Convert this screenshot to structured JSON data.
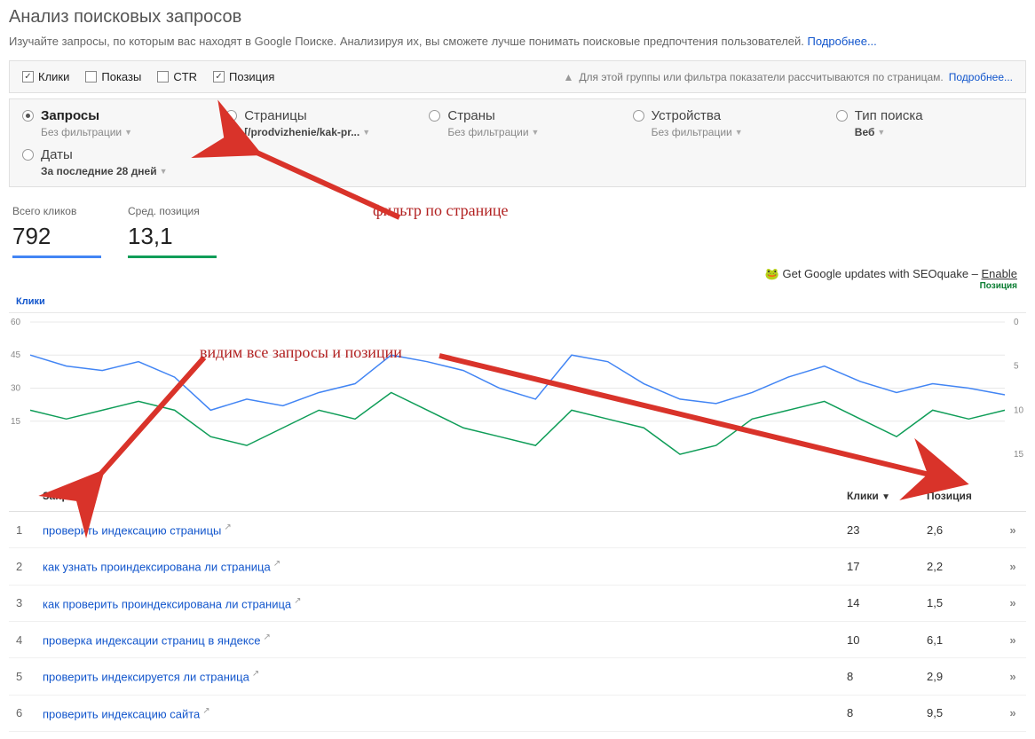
{
  "page": {
    "title": "Анализ поисковых запросов",
    "subtitle": "Изучайте запросы, по которым вас находят в Google Поиске. Анализируя их, вы сможете лучше понимать поисковые предпочтения пользователей.",
    "more_link": "Подробнее..."
  },
  "metrics": {
    "clicks": "Клики",
    "impressions": "Показы",
    "ctr": "CTR",
    "position": "Позиция",
    "note": "Для этой группы или фильтра показатели рассчитываются по страницам.",
    "note_link": "Подробнее..."
  },
  "filters": {
    "queries": {
      "label": "Запросы",
      "sub": "Без фильтрации"
    },
    "pages": {
      "label": "Страницы",
      "sub": "[/prodvizhenie/kak-pr..."
    },
    "countries": {
      "label": "Страны",
      "sub": "Без фильтрации"
    },
    "devices": {
      "label": "Устройства",
      "sub": "Без фильтрации"
    },
    "searchtype": {
      "label": "Тип поиска",
      "sub": "Веб"
    },
    "dates": {
      "label": "Даты",
      "sub": "За последние 28 дней"
    }
  },
  "stats": {
    "clicks_label": "Всего кликов",
    "clicks_value": "792",
    "pos_label": "Сред. позиция",
    "pos_value": "13,1"
  },
  "annotations": {
    "filter": "фильтр по странице",
    "queries": "видим все запросы и позиции"
  },
  "seoquake": {
    "text": "Get Google updates with SEOquake – ",
    "enable": "Enable",
    "position": "Позиция"
  },
  "chart_legend": {
    "clicks": "Клики"
  },
  "chart_data": {
    "type": "line",
    "y_left_ticks": [
      60,
      45,
      30,
      15
    ],
    "y_right_ticks": [
      0,
      5,
      10,
      15
    ],
    "x": [
      1,
      2,
      3,
      4,
      5,
      6,
      7,
      8,
      9,
      10,
      11,
      12,
      13,
      14,
      15,
      16,
      17,
      18,
      19,
      20,
      21,
      22,
      23,
      24,
      25,
      26,
      27,
      28
    ],
    "series": [
      {
        "name": "Клики",
        "axis": "left",
        "values": [
          45,
          40,
          38,
          42,
          35,
          20,
          25,
          22,
          28,
          32,
          45,
          42,
          38,
          30,
          25,
          45,
          42,
          32,
          25,
          23,
          28,
          35,
          40,
          33,
          28,
          32,
          30,
          27
        ]
      },
      {
        "name": "Позиция",
        "axis": "right",
        "values": [
          10,
          11,
          10,
          9,
          10,
          13,
          14,
          12,
          10,
          11,
          8,
          10,
          12,
          13,
          14,
          10,
          11,
          12,
          15,
          14,
          11,
          10,
          9,
          11,
          13,
          10,
          11,
          10
        ]
      }
    ]
  },
  "table": {
    "headers": {
      "queries": "Запросы",
      "clicks": "Клики",
      "position": "Позиция"
    },
    "rows": [
      {
        "idx": "1",
        "query": "проверить индексацию страницы",
        "clicks": "23",
        "position": "2,6"
      },
      {
        "idx": "2",
        "query": "как узнать проиндексирована ли страница",
        "clicks": "17",
        "position": "2,2"
      },
      {
        "idx": "3",
        "query": "как проверить проиндексирована ли страница",
        "clicks": "14",
        "position": "1,5"
      },
      {
        "idx": "4",
        "query": "проверка индексации страниц в яндексе",
        "clicks": "10",
        "position": "6,1"
      },
      {
        "idx": "5",
        "query": "проверить индексируется ли страница",
        "clicks": "8",
        "position": "2,9"
      },
      {
        "idx": "6",
        "query": "проверить индексацию сайта",
        "clicks": "8",
        "position": "9,5"
      }
    ]
  }
}
